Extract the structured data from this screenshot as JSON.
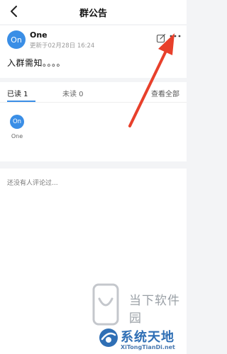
{
  "header": {
    "title": "群公告",
    "back_icon": "back-arrow-icon"
  },
  "post": {
    "author_initials": "On",
    "author": "One",
    "meta": "更新于02月28日 16:24",
    "content": "入群需知。。。。",
    "edit_icon": "edit-icon",
    "more_icon": "more-icon"
  },
  "readers": {
    "tab_read": "已读 1",
    "tab_unread": "未读 0",
    "view_all": "查看全部",
    "list": [
      {
        "initials": "On",
        "name": "One"
      }
    ]
  },
  "comments": {
    "empty_text": "还没有人评论过..."
  },
  "watermark": {
    "site_name": "当下软件园",
    "brand": "系统天地",
    "url": "XiTongTianDi.net"
  },
  "colors": {
    "accent": "#3a8ee6",
    "annotation_arrow": "#e8402b",
    "background": "#f3f4f6"
  }
}
